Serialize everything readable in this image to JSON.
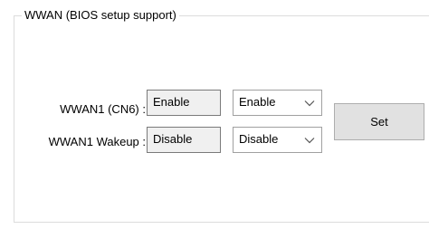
{
  "group": {
    "title": "WWAN (BIOS setup support)"
  },
  "rows": [
    {
      "label": "WWAN1 (CN6) :",
      "status": "Enable",
      "selected": "Enable"
    },
    {
      "label": "WWAN1 Wakeup :",
      "status": "Disable",
      "selected": "Disable"
    }
  ],
  "set_button": {
    "label": "Set"
  },
  "icons": {
    "dropdown": "chevron-down-icon"
  }
}
